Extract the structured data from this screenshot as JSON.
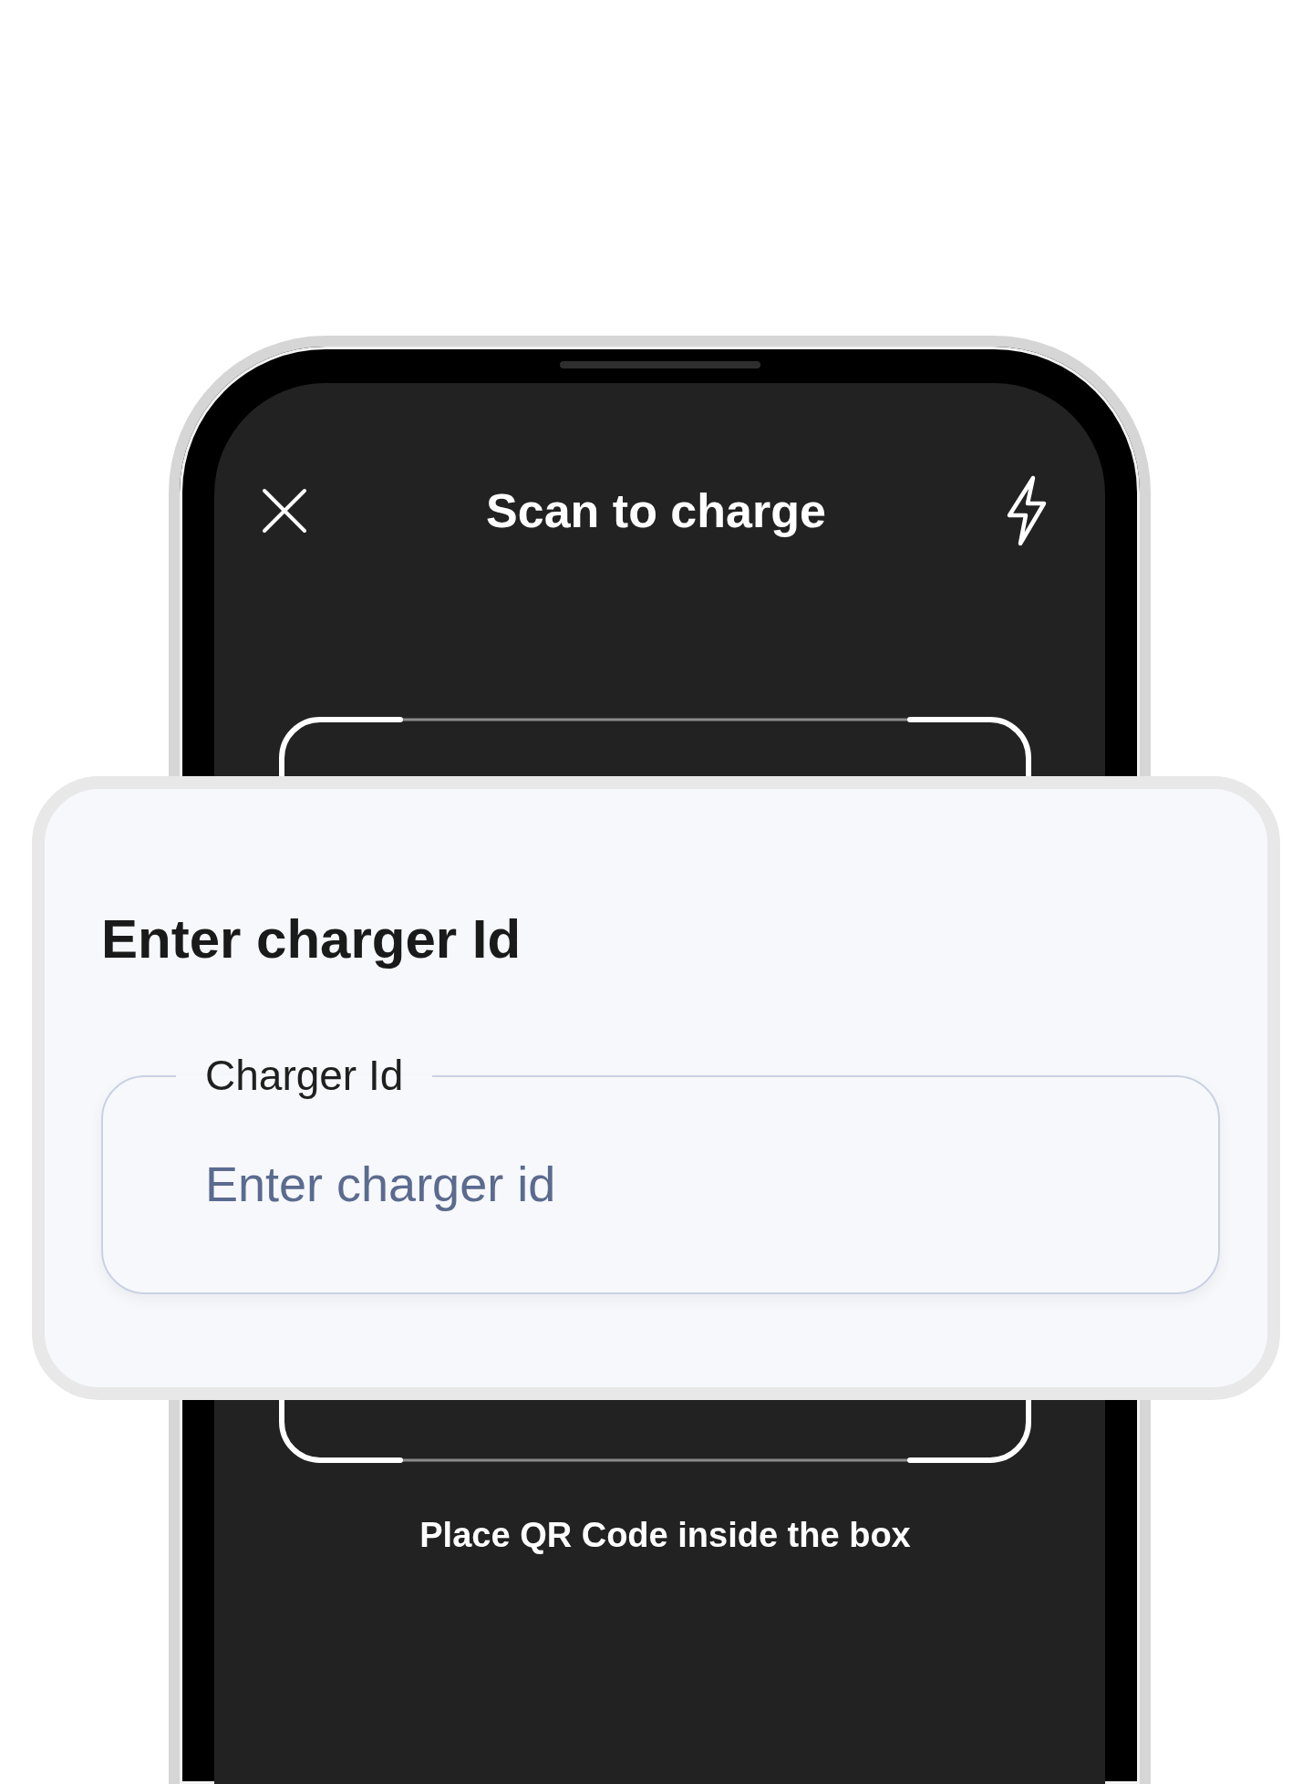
{
  "header": {
    "title": "Scan to charge"
  },
  "dialog": {
    "title": "Enter charger Id",
    "field": {
      "label": "Charger Id",
      "placeholder": "Enter charger id"
    }
  },
  "scanner": {
    "hint": "Place QR Code inside the box"
  }
}
